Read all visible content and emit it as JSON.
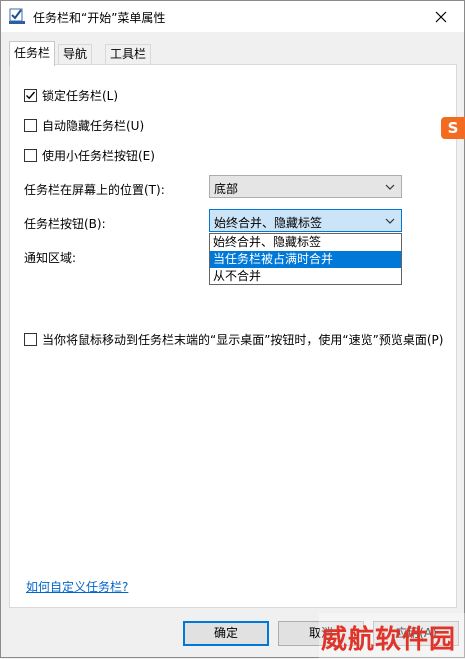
{
  "window": {
    "title": "任务栏和“开始”菜单属性"
  },
  "tabs": [
    {
      "label": "任务栏"
    },
    {
      "label": "导航"
    },
    {
      "label": "工具栏"
    }
  ],
  "options": {
    "lock": {
      "label": "锁定任务栏(L)",
      "checked": true
    },
    "autohide": {
      "label": "自动隐藏任务栏(U)",
      "checked": false
    },
    "small_buttons": {
      "label": "使用小任务栏按钮(E)",
      "checked": false
    },
    "peek": {
      "label": "当你将鼠标移动到任务栏末端的“显示桌面”按钮时，使用“速览”预览桌面(P)",
      "checked": false
    }
  },
  "position": {
    "label": "任务栏在屏幕上的位置(T):",
    "value": "底部"
  },
  "buttons_setting": {
    "label": "任务栏按钮(B):",
    "value": "始终合并、隐藏标签",
    "options": [
      "始终合并、隐藏标签",
      "当任务栏被占满时合并",
      "从不合并"
    ],
    "highlighted_index": 1
  },
  "notification": {
    "label": "通知区域:"
  },
  "help_link": "如何自定义任务栏?",
  "footer": {
    "ok": "确定",
    "cancel": "取消",
    "apply": "应用(A)"
  },
  "watermark": "威航软件园",
  "ime_badge": "S",
  "colors": {
    "accent": "#0078d7",
    "link": "#0066cc",
    "watermark": "#e0342a",
    "ime": "#f36a21"
  }
}
